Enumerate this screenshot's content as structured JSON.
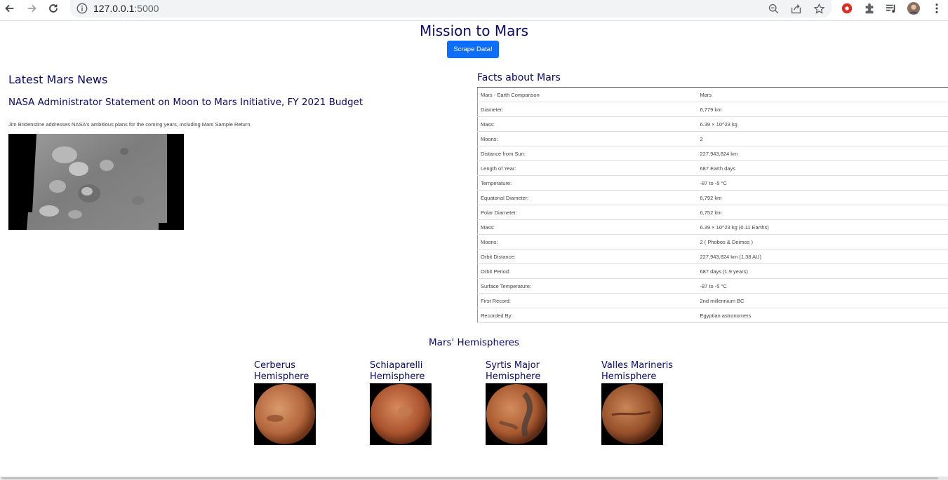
{
  "browser": {
    "url_host": "127.0.0.1",
    "url_port": ":5000"
  },
  "page": {
    "title": "Mission to Mars",
    "scrape_button": "Scrape Data!"
  },
  "news": {
    "heading": "Latest Mars News",
    "title": "NASA Administrator Statement on Moon to Mars Initiative, FY 2021 Budget",
    "paragraph": "Jim Bridenstine addresses NASA's ambitious plans for the coming years, including Mars Sample Return."
  },
  "facts": {
    "heading": "Facts about Mars",
    "rows": [
      [
        "Mars - Earth Comparison",
        "Mars"
      ],
      [
        "Diameter:",
        "6,779 km"
      ],
      [
        "Mass:",
        "6.39 × 10^23 kg"
      ],
      [
        "Moons:",
        "2"
      ],
      [
        "Distance from Sun:",
        "227,943,824 km"
      ],
      [
        "Length of Year:",
        "687 Earth days"
      ],
      [
        "Temperature:",
        "-87 to -5 °C"
      ],
      [
        "Equatorial Diameter:",
        "6,792 km"
      ],
      [
        "Polar Diameter:",
        "6,752 km"
      ],
      [
        "Mass:",
        "6.39 × 10^23 kg (0.11 Earths)"
      ],
      [
        "Moons:",
        "2 ( Phobos & Deimos )"
      ],
      [
        "Orbit Distance:",
        "227,943,824 km (1.38 AU)"
      ],
      [
        "Orbit Period:",
        "687 days (1.9 years)"
      ],
      [
        "Surface Temperature:",
        "-87 to -5 °C"
      ],
      [
        "First Record:",
        "2nd millennium BC"
      ],
      [
        "Recorded By:",
        "Egyptian astronomers"
      ]
    ]
  },
  "hemispheres": {
    "heading": "Mars' Hemispheres",
    "items": [
      {
        "name": "Cerberus Hemisphere"
      },
      {
        "name": "Schiaparelli Hemisphere"
      },
      {
        "name": "Syrtis Major Hemisphere"
      },
      {
        "name": "Valles Marineris Hemisphere"
      }
    ]
  },
  "colors": {
    "heading": "#0a0a6b",
    "button": "#0d6efd"
  }
}
